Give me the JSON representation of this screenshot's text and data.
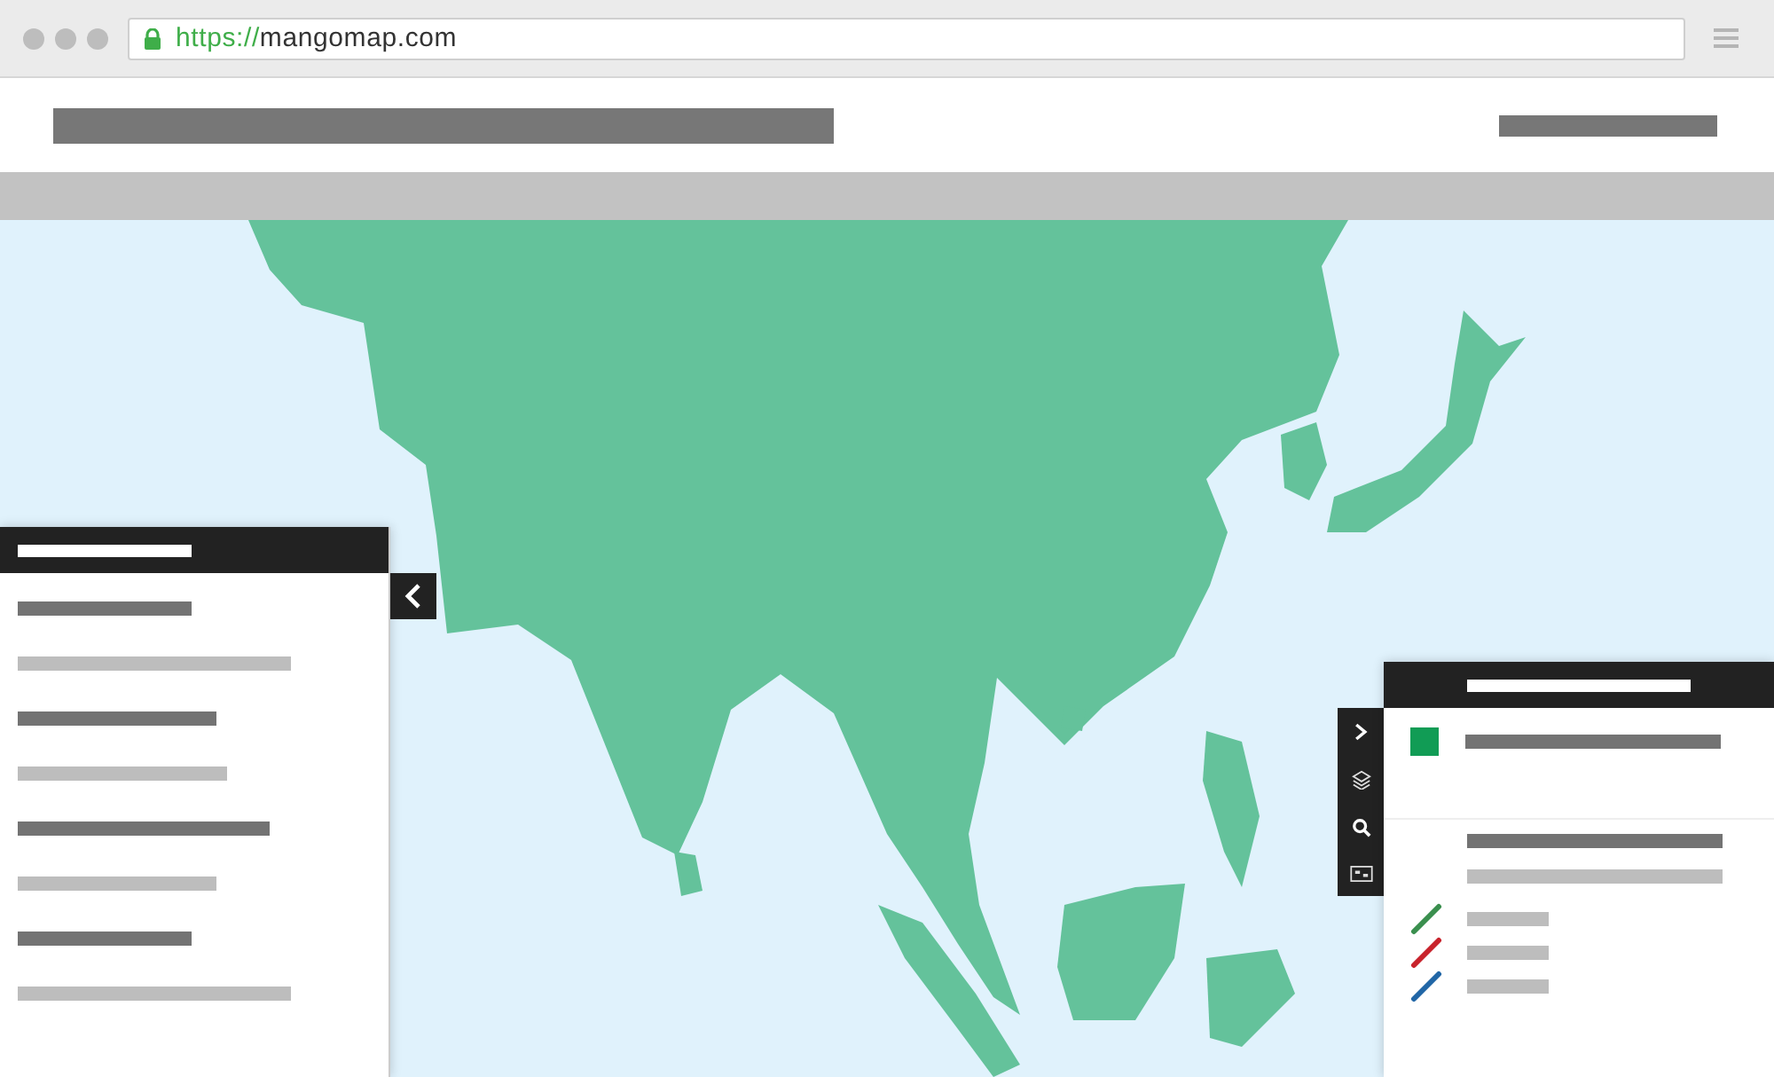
{
  "browser": {
    "url_scheme": "https://",
    "url_host": "mangomap.com"
  },
  "legend": [
    {
      "kind": "swatch",
      "color": "#119c55"
    },
    {
      "kind": "line",
      "color": "#3a8f4e"
    },
    {
      "kind": "line",
      "color": "#c8232c"
    },
    {
      "kind": "line",
      "color": "#2166a6"
    }
  ]
}
